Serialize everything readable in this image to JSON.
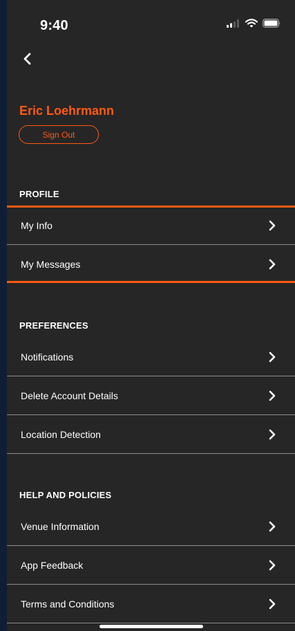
{
  "status_bar": {
    "time": "9:40",
    "icons": [
      "cellular-signal-icon",
      "wifi-icon",
      "battery-icon"
    ]
  },
  "nav": {
    "back_icon": "chevron-left-icon"
  },
  "user": {
    "name": "Eric Loehrmann",
    "sign_out_label": "Sign Out"
  },
  "sections": {
    "profile": {
      "title": "PROFILE",
      "items": [
        {
          "label": "My Info"
        },
        {
          "label": "My Messages"
        }
      ]
    },
    "preferences": {
      "title": "PREFERENCES",
      "items": [
        {
          "label": "Notifications"
        },
        {
          "label": "Delete Account Details"
        },
        {
          "label": "Location Detection"
        }
      ]
    },
    "help": {
      "title": "HELP AND POLICIES",
      "items": [
        {
          "label": "Venue Information"
        },
        {
          "label": "App Feedback"
        },
        {
          "label": "Terms and Conditions"
        }
      ]
    }
  },
  "colors": {
    "accent": "#ff5a12",
    "background": "#262626",
    "outer": "#0f1e36",
    "divider": "#8c8c8c",
    "text": "#ffffff"
  }
}
